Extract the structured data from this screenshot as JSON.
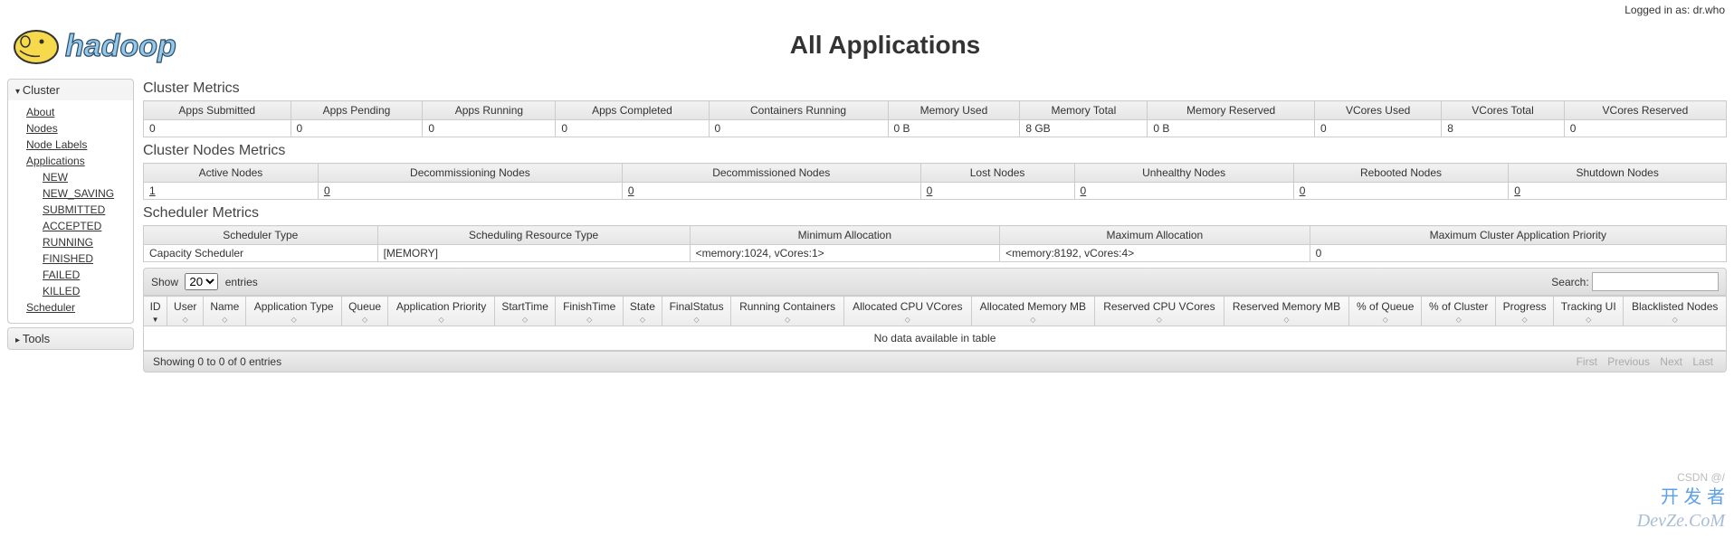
{
  "login": {
    "prefix": "Logged in as: ",
    "user": "dr.who"
  },
  "title": "All Applications",
  "sidebar": {
    "cluster": {
      "header": "Cluster",
      "links": [
        "About",
        "Nodes",
        "Node Labels",
        "Applications"
      ],
      "appStates": [
        "NEW",
        "NEW_SAVING",
        "SUBMITTED",
        "ACCEPTED",
        "RUNNING",
        "FINISHED",
        "FAILED",
        "KILLED"
      ],
      "scheduler": "Scheduler"
    },
    "tools": {
      "header": "Tools"
    }
  },
  "clusterMetrics": {
    "title": "Cluster Metrics",
    "headers": [
      "Apps Submitted",
      "Apps Pending",
      "Apps Running",
      "Apps Completed",
      "Containers Running",
      "Memory Used",
      "Memory Total",
      "Memory Reserved",
      "VCores Used",
      "VCores Total",
      "VCores Reserved"
    ],
    "values": [
      "0",
      "0",
      "0",
      "0",
      "0",
      "0 B",
      "8 GB",
      "0 B",
      "0",
      "8",
      "0"
    ]
  },
  "nodesMetrics": {
    "title": "Cluster Nodes Metrics",
    "headers": [
      "Active Nodes",
      "Decommissioning Nodes",
      "Decommissioned Nodes",
      "Lost Nodes",
      "Unhealthy Nodes",
      "Rebooted Nodes",
      "Shutdown Nodes"
    ],
    "values": [
      "1",
      "0",
      "0",
      "0",
      "0",
      "0",
      "0"
    ]
  },
  "schedulerMetrics": {
    "title": "Scheduler Metrics",
    "headers": [
      "Scheduler Type",
      "Scheduling Resource Type",
      "Minimum Allocation",
      "Maximum Allocation",
      "Maximum Cluster Application Priority"
    ],
    "values": [
      "Capacity Scheduler",
      "[MEMORY]",
      "<memory:1024, vCores:1>",
      "<memory:8192, vCores:4>",
      "0"
    ]
  },
  "datatable": {
    "showPrefix": "Show",
    "showSuffix": "entries",
    "pageSize": "20",
    "searchLabel": "Search:",
    "columns": [
      "ID",
      "User",
      "Name",
      "Application Type",
      "Queue",
      "Application Priority",
      "StartTime",
      "FinishTime",
      "State",
      "FinalStatus",
      "Running Containers",
      "Allocated CPU VCores",
      "Allocated Memory MB",
      "Reserved CPU VCores",
      "Reserved Memory MB",
      "% of Queue",
      "% of Cluster",
      "Progress",
      "Tracking UI",
      "Blacklisted Nodes"
    ],
    "empty": "No data available in table",
    "info": "Showing 0 to 0 of 0 entries",
    "paginate": [
      "First",
      "Previous",
      "Next",
      "Last"
    ]
  },
  "watermarks": {
    "csdn": "CSDN @/",
    "devze_cn": "开 发 者",
    "devze_en": "DevZe.CoM"
  }
}
